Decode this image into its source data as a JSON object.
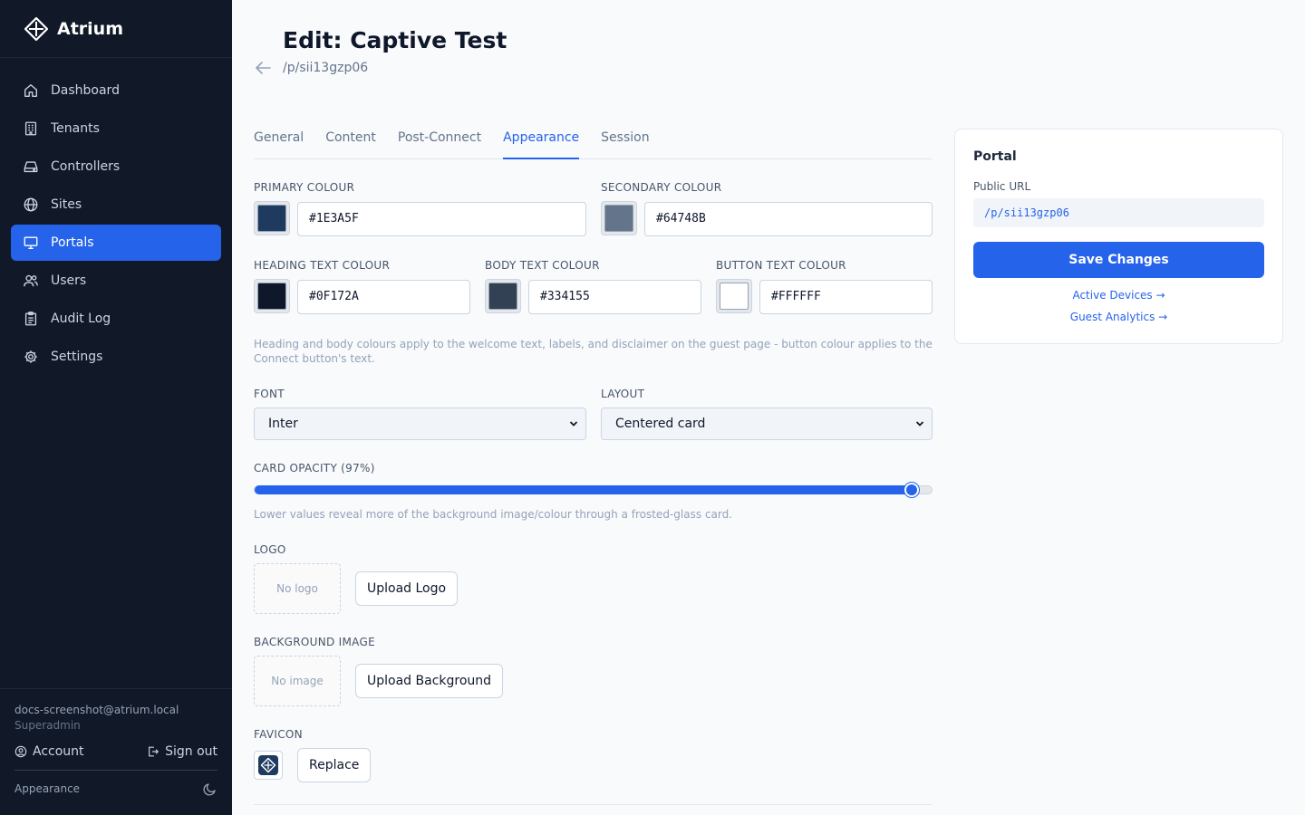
{
  "app": {
    "name": "Atrium"
  },
  "sidebar": {
    "items": [
      {
        "label": "Dashboard",
        "icon": "home-icon",
        "active": false
      },
      {
        "label": "Tenants",
        "icon": "building-icon",
        "active": false
      },
      {
        "label": "Controllers",
        "icon": "hard-drive-icon",
        "active": false
      },
      {
        "label": "Sites",
        "icon": "globe-icon",
        "active": false
      },
      {
        "label": "Portals",
        "icon": "monitor-icon",
        "active": true
      },
      {
        "label": "Users",
        "icon": "users-icon",
        "active": false
      },
      {
        "label": "Audit Log",
        "icon": "clipboard-icon",
        "active": false
      },
      {
        "label": "Settings",
        "icon": "gear-icon",
        "active": false
      }
    ],
    "user_email": "docs-screenshot@atrium.local",
    "user_role": "Superadmin",
    "account_label": "Account",
    "signout_label": "Sign out",
    "appearance_label": "Appearance"
  },
  "header": {
    "title": "Edit: Captive Test",
    "path": "/p/sii13gzp06"
  },
  "tabs": [
    {
      "label": "General",
      "active": false
    },
    {
      "label": "Content",
      "active": false
    },
    {
      "label": "Post-Connect",
      "active": false
    },
    {
      "label": "Appearance",
      "active": true
    },
    {
      "label": "Session",
      "active": false
    }
  ],
  "colors": {
    "primary": {
      "label": "PRIMARY COLOUR",
      "value": "#1E3A5F"
    },
    "secondary": {
      "label": "SECONDARY COLOUR",
      "value": "#64748B"
    },
    "heading": {
      "label": "HEADING TEXT COLOUR",
      "value": "#0F172A"
    },
    "body": {
      "label": "BODY TEXT COLOUR",
      "value": "#334155"
    },
    "button": {
      "label": "BUTTON TEXT COLOUR",
      "value": "#FFFFFF"
    },
    "help": "Heading and body colours apply to the welcome text, labels, and disclaimer on the guest page - button colour applies to the Connect button's text."
  },
  "font": {
    "label": "FONT",
    "value": "Inter"
  },
  "layout": {
    "label": "LAYOUT",
    "value": "Centered card"
  },
  "opacity": {
    "label": "CARD OPACITY (97%)",
    "value": 97,
    "help": "Lower values reveal more of the background image/colour through a frosted-glass card."
  },
  "logo": {
    "label": "LOGO",
    "placeholder": "No logo",
    "button": "Upload Logo"
  },
  "background": {
    "label": "BACKGROUND IMAGE",
    "placeholder": "No image",
    "button": "Upload Background"
  },
  "favicon": {
    "label": "FAVICON",
    "button": "Replace"
  },
  "portal_card": {
    "title": "Portal",
    "url_label": "Public URL",
    "url": "/p/sii13gzp06",
    "save": "Save Changes",
    "link_devices": "Active Devices →",
    "link_analytics": "Guest Analytics →"
  },
  "theme": {
    "accent": "#2563eb",
    "sidebar_bg": "#111827"
  }
}
